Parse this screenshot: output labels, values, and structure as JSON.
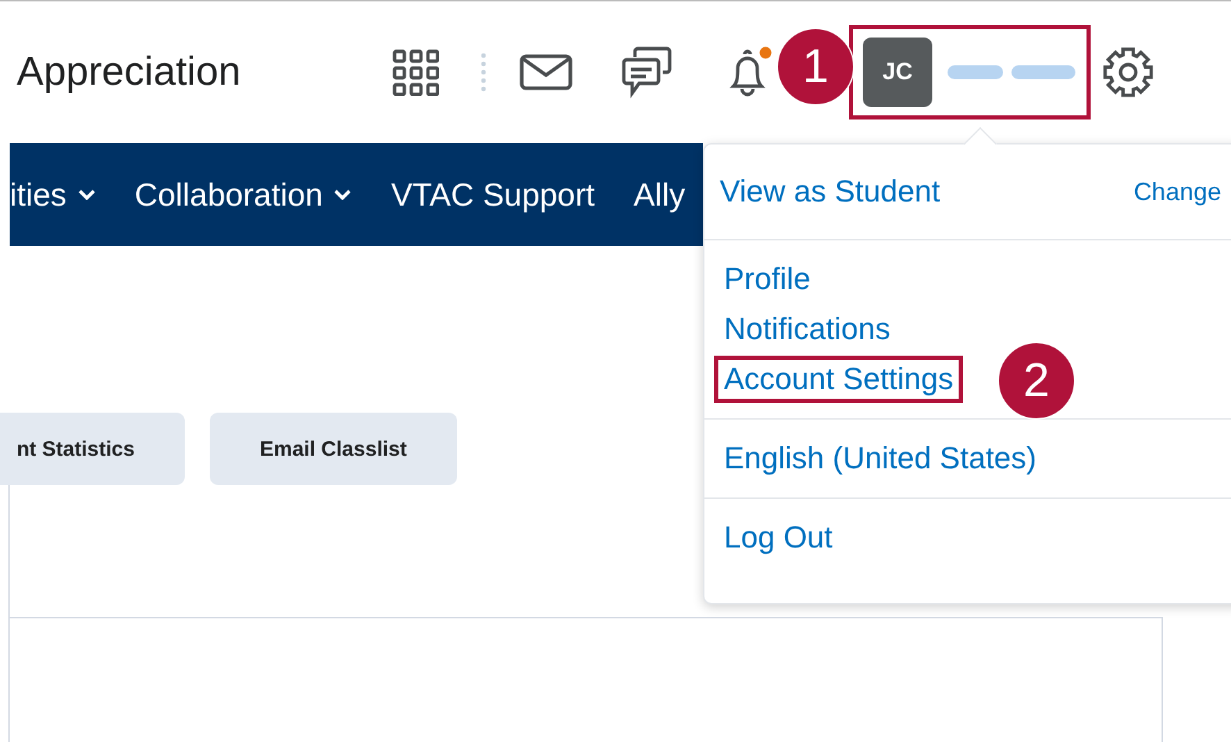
{
  "header": {
    "title": "Appreciation",
    "bell": {
      "unread": true
    },
    "user": {
      "initials": "JC",
      "highlighted": true
    }
  },
  "nav": [
    {
      "label": "ities",
      "has_menu": true
    },
    {
      "label": "Collaboration",
      "has_menu": true
    },
    {
      "label": "VTAC Support",
      "has_menu": false
    },
    {
      "label": "Ally",
      "has_menu": false
    }
  ],
  "buttons": [
    "nt Statistics",
    "Email Classlist"
  ],
  "menu": {
    "title": "View as Student",
    "action": "Change",
    "sections": [
      [
        {
          "label": "Profile",
          "highlighted": false
        },
        {
          "label": "Notifications",
          "highlighted": false
        },
        {
          "label": "Account Settings",
          "highlighted": true
        }
      ],
      [
        {
          "label": "English (United States)",
          "highlighted": false
        }
      ],
      [
        {
          "label": "Log Out",
          "highlighted": false
        }
      ]
    ]
  },
  "callouts": [
    {
      "number": "1"
    },
    {
      "number": "2"
    }
  ]
}
